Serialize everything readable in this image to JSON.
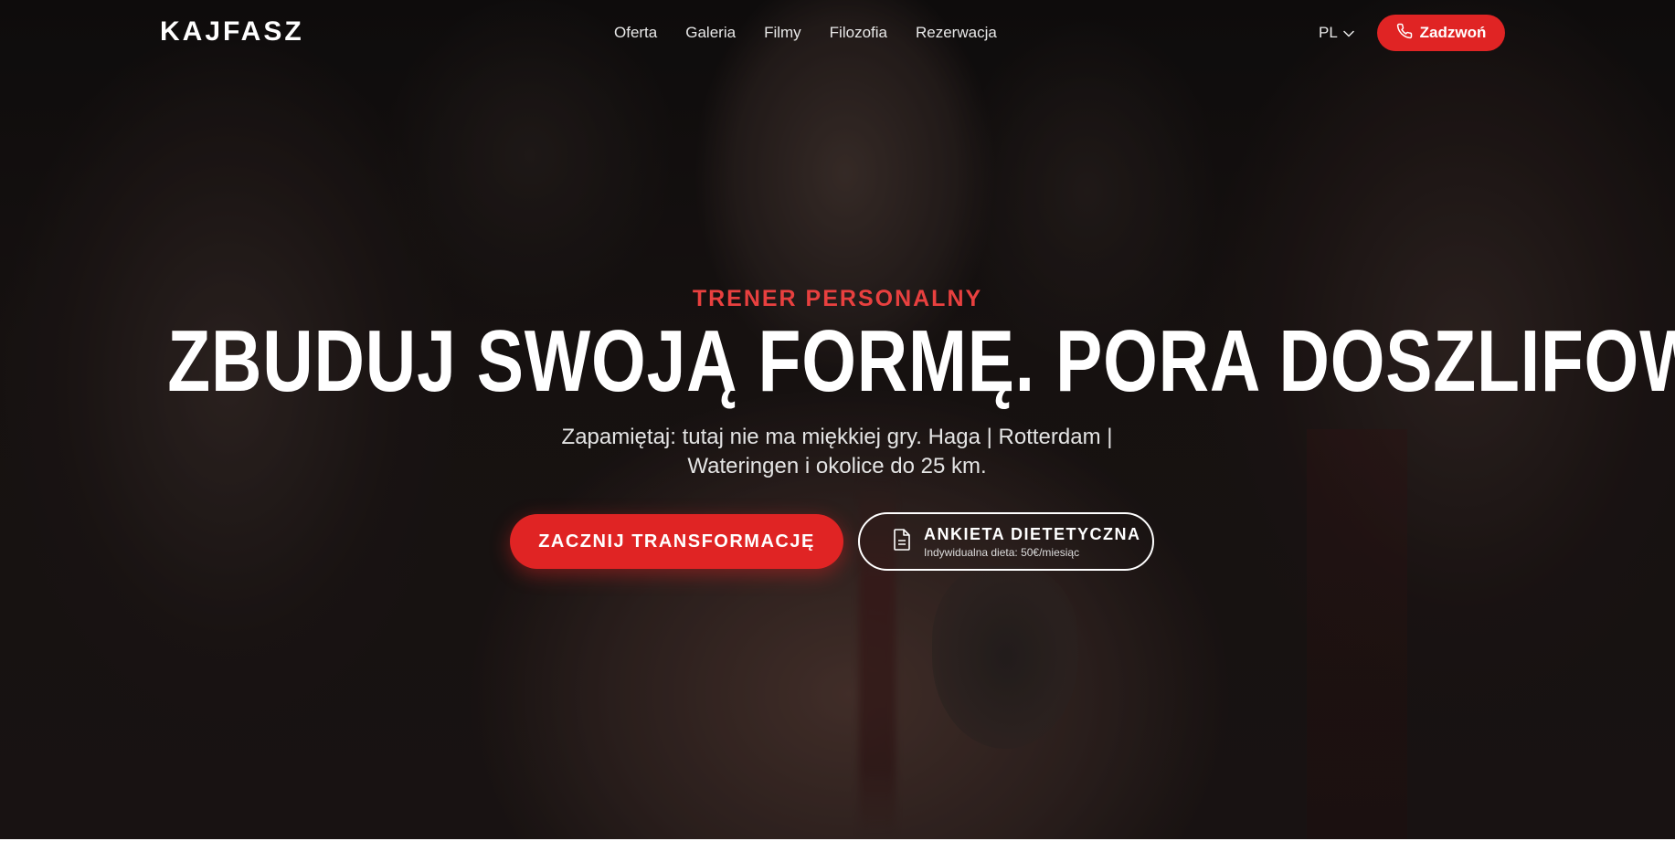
{
  "brand": {
    "logo": "KAJFASZ"
  },
  "nav": {
    "items": [
      {
        "label": "Oferta"
      },
      {
        "label": "Galeria"
      },
      {
        "label": "Filmy"
      },
      {
        "label": "Filozofia"
      },
      {
        "label": "Rezerwacja"
      }
    ]
  },
  "header": {
    "language": "PL",
    "language_icon": "chevron-down-icon",
    "call_label": "Zadzwoń",
    "call_icon": "phone-icon"
  },
  "hero": {
    "kicker": "TRENER PERSONALNY",
    "headline": "ZBUDUJ SWOJĄ FORMĘ. PORA DOSZLIFOWAĆ DIAMENT.",
    "subtext": "Zapamiętaj: tutaj nie ma miękkiej gry. Haga | Rotterdam | Wateringen i okolice do 25 km.",
    "cta_primary": "ZACZNIJ TRANSFORMACJĘ",
    "cta_secondary": {
      "title": "ANKIETA DIETETYCZNA",
      "subtitle": "Indywidualna dieta: 50€/miesiąc",
      "icon": "document-icon"
    }
  },
  "colors": {
    "accent": "#e02424",
    "kicker": "#e8403f",
    "text": "#ffffff"
  }
}
